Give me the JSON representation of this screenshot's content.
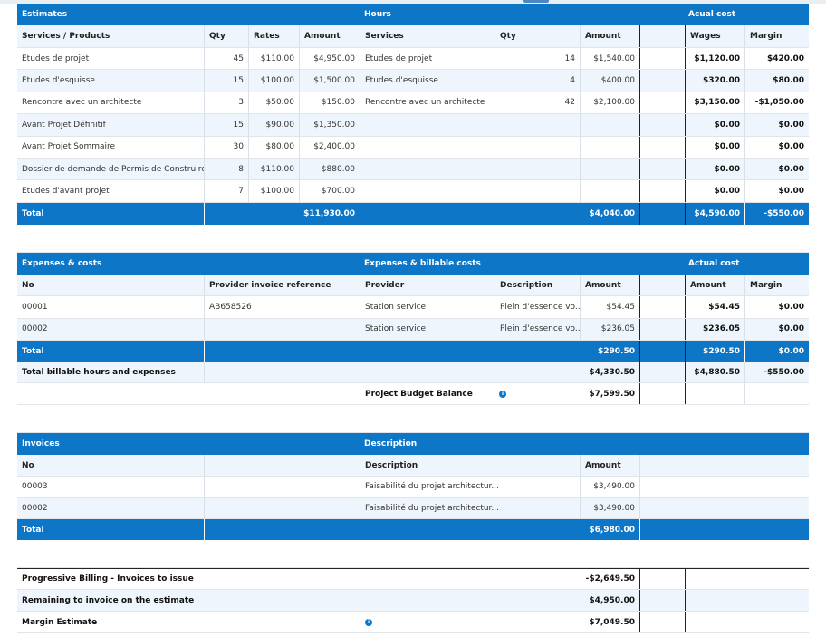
{
  "estimates": {
    "section_titles": {
      "estimates": "Estimates",
      "hours": "Hours",
      "actual_cost": "Acual cost"
    },
    "col_headers": {
      "services_products": "Services / Products",
      "qty": "Qty",
      "rates": "Rates",
      "amount": "Amount",
      "services": "Services",
      "qty2": "Qty",
      "amount2": "Amount",
      "wages": "Wages",
      "margin": "Margin"
    },
    "rows": [
      {
        "service": "Etudes de projet",
        "qty": "45",
        "rate": "$110.00",
        "amount": "$4,950.00",
        "h_service": "Etudes de projet",
        "h_qty": "14",
        "h_amount": "$1,540.00",
        "wages": "$1,120.00",
        "margin": "$420.00"
      },
      {
        "service": "Etudes d'esquisse",
        "qty": "15",
        "rate": "$100.00",
        "amount": "$1,500.00",
        "h_service": "Etudes d'esquisse",
        "h_qty": "4",
        "h_amount": "$400.00",
        "wages": "$320.00",
        "margin": "$80.00"
      },
      {
        "service": "Rencontre avec un architecte",
        "qty": "3",
        "rate": "$50.00",
        "amount": "$150.00",
        "h_service": "Rencontre avec un architecte",
        "h_qty": "42",
        "h_amount": "$2,100.00",
        "wages": "$3,150.00",
        "margin": "-$1,050.00"
      },
      {
        "service": "Avant Projet Définitif",
        "qty": "15",
        "rate": "$90.00",
        "amount": "$1,350.00",
        "h_service": "",
        "h_qty": "",
        "h_amount": "",
        "wages": "$0.00",
        "margin": "$0.00"
      },
      {
        "service": "Avant Projet Sommaire",
        "qty": "30",
        "rate": "$80.00",
        "amount": "$2,400.00",
        "h_service": "",
        "h_qty": "",
        "h_amount": "",
        "wages": "$0.00",
        "margin": "$0.00"
      },
      {
        "service": "Dossier de demande de Permis de Construire",
        "qty": "8",
        "rate": "$110.00",
        "amount": "$880.00",
        "h_service": "",
        "h_qty": "",
        "h_amount": "",
        "wages": "$0.00",
        "margin": "$0.00"
      },
      {
        "service": "Etudes d'avant projet",
        "qty": "7",
        "rate": "$100.00",
        "amount": "$700.00",
        "h_service": "",
        "h_qty": "",
        "h_amount": "",
        "wages": "$0.00",
        "margin": "$0.00"
      }
    ],
    "total": {
      "label": "Total",
      "amount": "$11,930.00",
      "h_amount": "$4,040.00",
      "wages": "$4,590.00",
      "margin": "-$550.00"
    }
  },
  "expenses": {
    "section_titles": {
      "expenses_costs": "Expenses & costs",
      "billable": "Expenses & billable costs",
      "actual_cost": "Actual cost"
    },
    "col_headers": {
      "no": "No",
      "provider_ref": "Provider invoice reference",
      "provider": "Provider",
      "description": "Description",
      "amount": "Amount",
      "amount2": "Amount",
      "margin": "Margin"
    },
    "rows": [
      {
        "no": "00001",
        "ref": "AB658526",
        "provider": "Station service",
        "description": "Plein d'essence vo...",
        "amount": "$54.45",
        "actual": "$54.45",
        "margin": "$0.00"
      },
      {
        "no": "00002",
        "ref": "",
        "provider": "Station service",
        "description": "Plein d'essence vo...",
        "amount": "$236.05",
        "actual": "$236.05",
        "margin": "$0.00"
      }
    ],
    "total": {
      "label": "Total",
      "amount": "$290.50",
      "actual": "$290.50",
      "margin": "$0.00"
    },
    "total_billable": {
      "label": "Total billable hours and expenses",
      "amount": "$4,330.50",
      "actual": "$4,880.50",
      "margin": "-$550.00"
    },
    "budget_balance": {
      "label": "Project Budget Balance",
      "amount": "$7,599.50"
    }
  },
  "invoices": {
    "section_titles": {
      "invoices": "Invoices",
      "description": "Description"
    },
    "col_headers": {
      "no": "No",
      "description": "Description",
      "amount": "Amount"
    },
    "rows": [
      {
        "no": "00003",
        "description": "Faisabilité du projet architectur...",
        "amount": "$3,490.00"
      },
      {
        "no": "00002",
        "description": "Faisabilité du projet architectur...",
        "amount": "$3,490.00"
      }
    ],
    "total": {
      "label": "Total",
      "amount": "$6,980.00"
    }
  },
  "summary": {
    "progressive_billing": {
      "label": "Progressive Billing - Invoices to issue",
      "amount": "-$2,649.50"
    },
    "remaining": {
      "label": "Remaining to invoice on the estimate",
      "amount": "$4,950.00"
    },
    "margin_estimate": {
      "label": "Margin Estimate",
      "amount": "$7,049.50"
    }
  },
  "colors": {
    "header_blue": "#0e76c7",
    "row_light": "#eef5fc"
  },
  "icons": {
    "info": "info-icon"
  }
}
